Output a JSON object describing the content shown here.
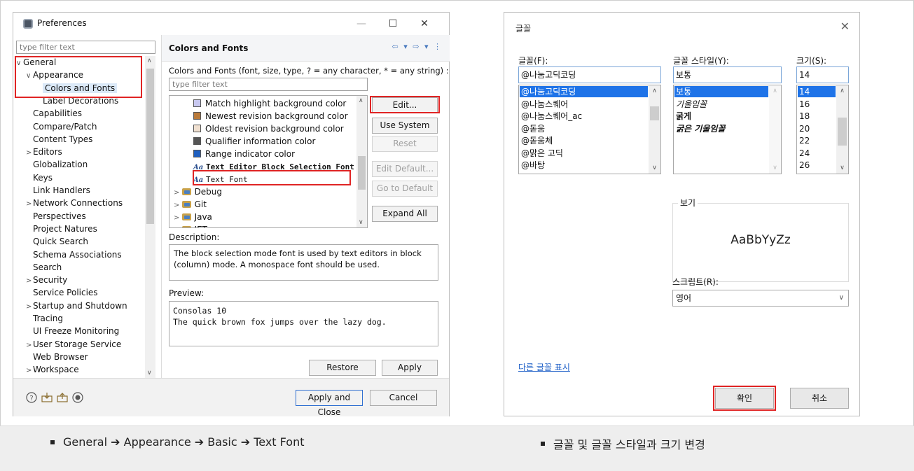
{
  "preferences": {
    "title": "Preferences",
    "window_buttons": {
      "minimize": "—",
      "maximize": "☐",
      "close": "✕"
    },
    "filter_placeholder": "type filter text",
    "tree": [
      {
        "label": "General",
        "arrow": "∨",
        "indent": 0
      },
      {
        "label": "Appearance",
        "arrow": "∨",
        "indent": 1
      },
      {
        "label": "Colors and Fonts",
        "arrow": "",
        "indent": 2
      },
      {
        "label": "Label Decorations",
        "arrow": "",
        "indent": 2
      },
      {
        "label": "Capabilities",
        "arrow": "",
        "indent": 1
      },
      {
        "label": "Compare/Patch",
        "arrow": "",
        "indent": 1
      },
      {
        "label": "Content Types",
        "arrow": "",
        "indent": 1
      },
      {
        "label": "Editors",
        "arrow": ">",
        "indent": 1
      },
      {
        "label": "Globalization",
        "arrow": "",
        "indent": 1
      },
      {
        "label": "Keys",
        "arrow": "",
        "indent": 1
      },
      {
        "label": "Link Handlers",
        "arrow": "",
        "indent": 1
      },
      {
        "label": "Network Connections",
        "arrow": ">",
        "indent": 1
      },
      {
        "label": "Perspectives",
        "arrow": "",
        "indent": 1
      },
      {
        "label": "Project Natures",
        "arrow": "",
        "indent": 1
      },
      {
        "label": "Quick Search",
        "arrow": "",
        "indent": 1
      },
      {
        "label": "Schema Associations",
        "arrow": "",
        "indent": 1
      },
      {
        "label": "Search",
        "arrow": "",
        "indent": 1
      },
      {
        "label": "Security",
        "arrow": ">",
        "indent": 1
      },
      {
        "label": "Service Policies",
        "arrow": "",
        "indent": 1
      },
      {
        "label": "Startup and Shutdown",
        "arrow": ">",
        "indent": 1
      },
      {
        "label": "Tracing",
        "arrow": "",
        "indent": 1
      },
      {
        "label": "UI Freeze Monitoring",
        "arrow": "",
        "indent": 1
      },
      {
        "label": "User Storage Service",
        "arrow": ">",
        "indent": 1
      },
      {
        "label": "Web Browser",
        "arrow": "",
        "indent": 1
      },
      {
        "label": "Workspace",
        "arrow": ">",
        "indent": 1
      }
    ],
    "pane_title": "Colors and Fonts",
    "pane_nav": "⇦ ▾ ⇨ ▾ ⋮",
    "pane_description": "Colors and Fonts (font, size, type, ? = any character, * = any string) :",
    "pane_filter_placeholder": "type filter text",
    "cf_items": [
      {
        "label": "Match highlight background color",
        "kind": "swatch",
        "color": "#c8c8f0"
      },
      {
        "label": "Newest revision background color",
        "kind": "swatch",
        "color": "#b97a3a"
      },
      {
        "label": "Oldest revision background color",
        "kind": "swatch",
        "color": "#f0e0d0"
      },
      {
        "label": "Qualifier information color",
        "kind": "swatch",
        "color": "#555555"
      },
      {
        "label": "Range indicator color",
        "kind": "swatch",
        "color": "#1f5fbf"
      },
      {
        "label": "Text Editor Block Selection Font",
        "kind": "font"
      },
      {
        "label": "Text Font",
        "kind": "font"
      },
      {
        "label": "Debug",
        "kind": "folder"
      },
      {
        "label": "Git",
        "kind": "folder"
      },
      {
        "label": "Java",
        "kind": "folder"
      },
      {
        "label": "JET",
        "kind": "folder"
      }
    ],
    "buttons": {
      "edit": "Edit...",
      "use_system_font": "Use System Font",
      "reset": "Reset",
      "edit_default": "Edit Default...",
      "go_to_default": "Go to Default",
      "expand_all": "Expand All",
      "restore_defaults": "Restore Defaults",
      "apply": "Apply",
      "apply_and_close": "Apply and Close",
      "cancel": "Cancel"
    },
    "description_label": "Description:",
    "description_text": "The block selection mode font is used by text editors in block (column) mode. A monospace font should be used.",
    "preview_label": "Preview:",
    "preview_text": "Consolas 10\nThe quick brown fox jumps over the lazy dog."
  },
  "font_dialog": {
    "title": "글꼴",
    "close": "✕",
    "font_label": "글꼴(F):",
    "font_value": "@나눔고딕코딩",
    "fonts": [
      "@나눔고딕코딩",
      "@나눔스퀘어",
      "@나눔스퀘어_ac",
      "@돋움",
      "@돋움체",
      "@맑은 고딕",
      "@바탕"
    ],
    "style_label": "글꼴 스타일(Y):",
    "style_value": "보통",
    "styles": [
      "보통",
      "기울임꼴",
      "굵게",
      "굵은 기울임꼴"
    ],
    "size_label": "크기(S):",
    "size_value": "14",
    "sizes": [
      "14",
      "16",
      "18",
      "20",
      "22",
      "24",
      "26"
    ],
    "sample_label": "보기",
    "sample_text": "AaBbYyZz",
    "script_label": "스크립트(R):",
    "script_value": "영어",
    "more_fonts_link": "다른 글꼴 표시",
    "ok": "확인",
    "cancel": "취소"
  },
  "captions": {
    "left": "General ➔ Appearance ➔ Basic ➔ Text Font",
    "right": "글꼴 및 글꼴 스타일과 크기 변경"
  },
  "colors": {
    "highlight_red": "#e02424",
    "selection_blue": "#1e73e8"
  }
}
